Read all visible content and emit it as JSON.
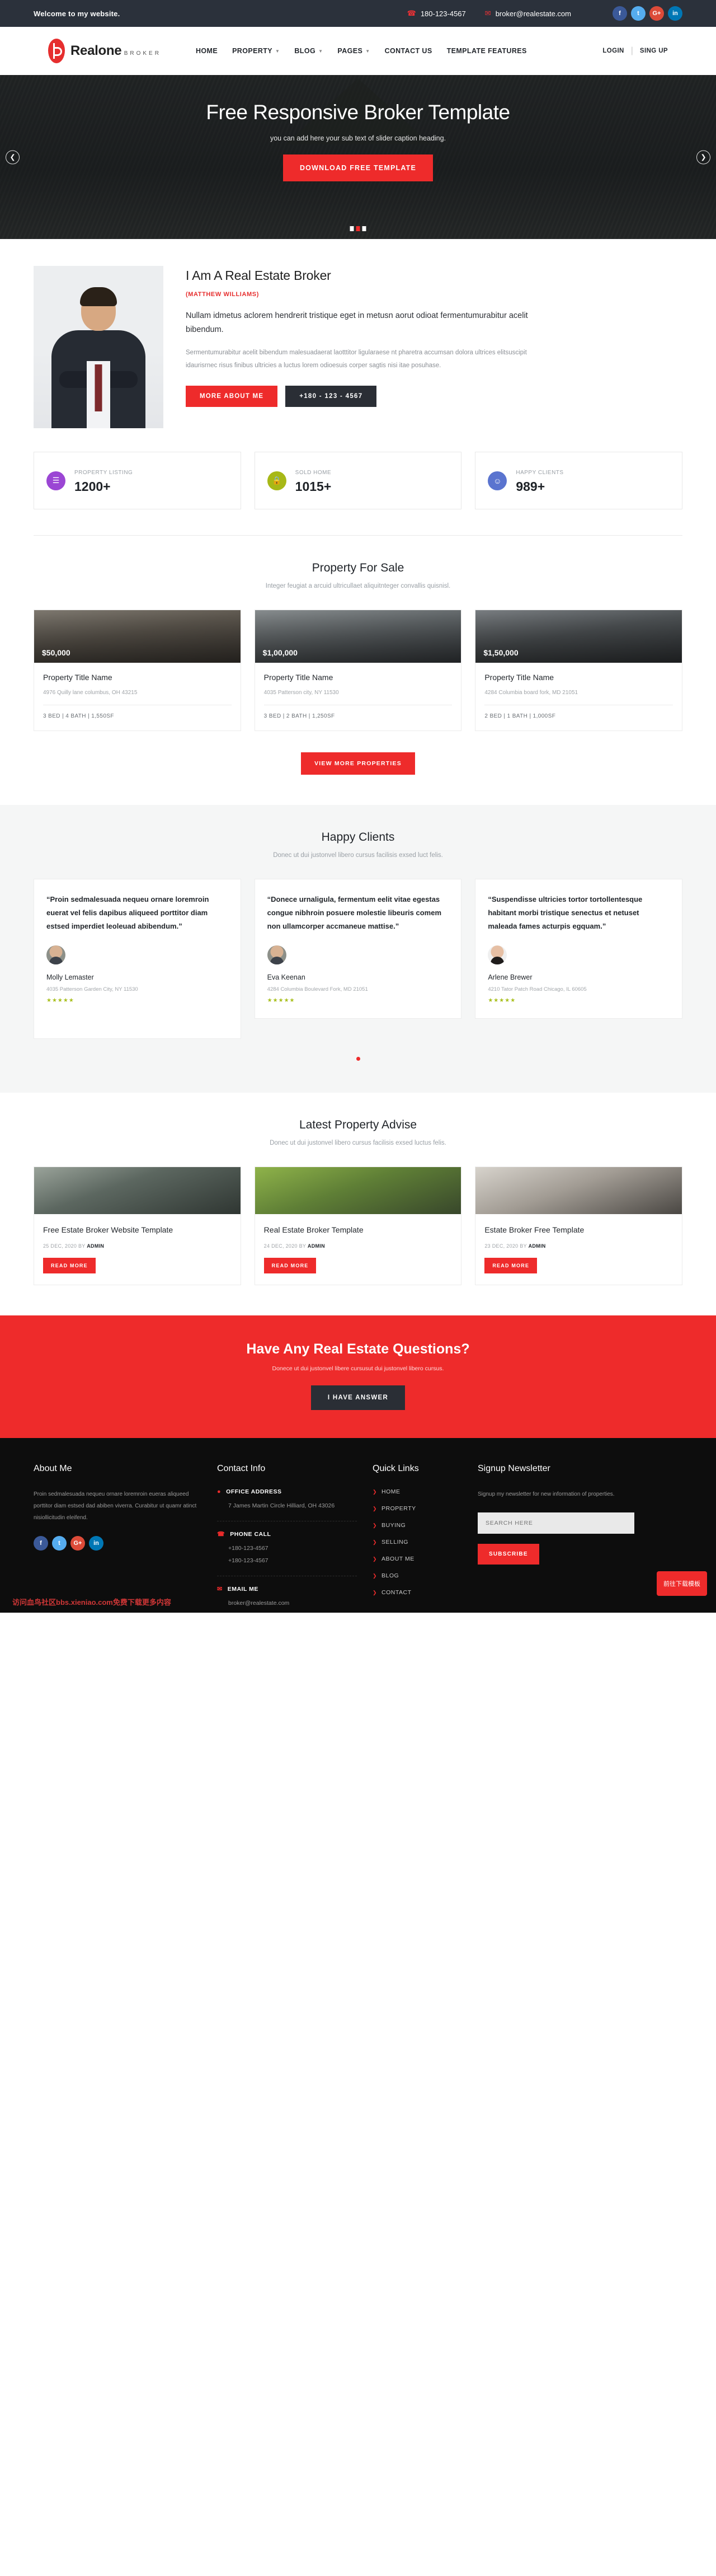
{
  "topbar": {
    "welcome": "Welcome to my website.",
    "phone": "180-123-4567",
    "email": "broker@realestate.com",
    "phone_icon": "phone-icon",
    "email_icon": "envelope-icon",
    "social": [
      {
        "name": "facebook",
        "glyph": "f"
      },
      {
        "name": "twitter",
        "glyph": "t"
      },
      {
        "name": "google-plus",
        "glyph": "G+"
      },
      {
        "name": "linkedin",
        "glyph": "in"
      }
    ]
  },
  "header": {
    "logo_name": "Realone",
    "logo_sub": "BROKER",
    "nav": [
      {
        "label": "HOME",
        "caret": false
      },
      {
        "label": "PROPERTY",
        "caret": true
      },
      {
        "label": "BLOG",
        "caret": true
      },
      {
        "label": "PAGES",
        "caret": true
      },
      {
        "label": "CONTACT US",
        "caret": false
      },
      {
        "label": "TEMPLATE FEATURES",
        "caret": false
      }
    ],
    "login": "LOGIN",
    "signup": "SING UP"
  },
  "hero": {
    "title": "Free Responsive Broker Template",
    "subtitle": "you can add here your sub text of slider caption heading.",
    "cta": "DOWNLOAD FREE TEMPLATE",
    "prev_icon": "chevron-left-icon",
    "next_icon": "chevron-right-icon",
    "slides": 3,
    "active_slide": 2
  },
  "intro": {
    "heading": "I Am A Real Estate Broker",
    "name": "(MATTHEW WILLIAMS)",
    "lead": "Nullam idmetus aclorem hendrerit tristique eget in metusn aorut odioat fermentumurabitur acelit bibendum.",
    "paragraph": "Sermentumurabitur acelit bibendum malesuadaerat laotttitor ligularaese nt pharetra accumsan dolora ultrices elitsuscipit idaurisrnec risus finibus ultricies a luctus lorem odioesuis corper sagtis nisi itae posuhase.",
    "btn_primary": "MORE ABOUT ME",
    "btn_phone": "+180 - 123 - 4567"
  },
  "stats": [
    {
      "label": "PROPERTY LISTING",
      "value": "1200+",
      "color": "#9b46d4",
      "icon": "list-icon",
      "glyph": "☰"
    },
    {
      "label": "SOLD HOME",
      "value": "1015+",
      "color": "#a7b817",
      "icon": "lock-icon",
      "glyph": "⚿"
    },
    {
      "label": "HAPPY CLIENTS",
      "value": "989+",
      "color": "#5a74cf",
      "icon": "smile-icon",
      "glyph": "☺"
    }
  ],
  "property_section": {
    "heading": "Property For Sale",
    "subheading": "Integer feugiat a arcuid ultricullaet aliquitnteger convallis quisnisl.",
    "more_button": "VIEW MORE PROPERTIES",
    "items": [
      {
        "price": "$50,000",
        "title": "Property Title Name",
        "address": "4976 Quilly lane columbus, OH 43215",
        "meta": "3 BED  |  4 BATH  |  1,550SF"
      },
      {
        "price": "$1,00,000",
        "title": "Property Title Name",
        "address": "4035 Patterson city, NY 11530",
        "meta": "3 BED  |  2 BATH  |  1,250SF"
      },
      {
        "price": "$1,50,000",
        "title": "Property Title Name",
        "address": "4284 Columbia board fork, MD 21051",
        "meta": "2 BED  |  1 BATH  |  1,000SF"
      }
    ]
  },
  "testimonial_section": {
    "heading": "Happy Clients",
    "subheading": "Donec ut dui justonvel libero cursus facilisis exsed luct felis.",
    "items": [
      {
        "quote": "“Proin sedmalesuada nequeu ornare loremroin euerat vel felis dapibus aliqueed porttitor diam estsed imperdiet leoleuad abibendum.”",
        "name": "Molly Lemaster",
        "address": "4035 Patterson Garden City, NY 11530",
        "stars": "★★★★★"
      },
      {
        "quote": "“Donece urnaligula, fermentum eelit vitae egestas congue nibhroin posuere molestie libeuris comem non ullamcorper accmaneue mattise.”",
        "name": "Eva Keenan",
        "address": "4284 Columbia Boulevard Fork, MD 21051",
        "stars": "★★★★★"
      },
      {
        "quote": "“Suspendisse ultricies tortor tortollentesque habitant morbi tristique senectus et netuset maleada fames acturpis egquam.”",
        "name": "Arlene Brewer",
        "address": "4210 Tator Patch Road Chicago, IL 60605",
        "stars": "★★★★★"
      }
    ]
  },
  "blog_section": {
    "heading": "Latest Property Advise",
    "subheading": "Donec ut dui justonvel libero cursus facilisis exsed luctus felis.",
    "items": [
      {
        "title": "Free Estate Broker Website Template",
        "date": "25 DEC, 2020",
        "by_label": "BY",
        "author": "ADMIN",
        "read": "READ MORE"
      },
      {
        "title": "Real Estate Broker Template",
        "date": "24 DEC, 2020",
        "by_label": "BY",
        "author": "ADMIN",
        "read": "READ MORE"
      },
      {
        "title": "Estate Broker Free Template",
        "date": "23 DEC, 2020",
        "by_label": "BY",
        "author": "ADMIN",
        "read": "READ MORE"
      }
    ]
  },
  "cta": {
    "heading": "Have Any Real Estate Questions?",
    "sub": "Donece ut dui justonvel libere cursusut dui justonvel libero cursus.",
    "button": "I HAVE ANSWER"
  },
  "footer": {
    "about": {
      "heading": "About Me",
      "text": "Proin sedmalesuada nequeu ornare loremroin eueras aliqueed porttitor diam estsed dad abiben viverra. Curabitur ut quamr atinct nisiollicitudin eleifend.",
      "social": [
        {
          "name": "facebook",
          "glyph": "f"
        },
        {
          "name": "twitter",
          "glyph": "t"
        },
        {
          "name": "google-plus",
          "glyph": "G+"
        },
        {
          "name": "linkedin",
          "glyph": "in"
        }
      ]
    },
    "contact": {
      "heading": "Contact Info",
      "address_label": "OFFICE ADDRESS",
      "address_value": "7 James Martin Circle Hilliard, OH 43026",
      "phone_label": "PHONE CALL",
      "phone_1": "+180-123-4567",
      "phone_2": "+180-123-4567",
      "email_label": "EMAIL ME",
      "email_value": "broker@realestate.com",
      "address_icon": "map-pin-icon",
      "phone_icon": "phone-icon",
      "email_icon": "envelope-icon"
    },
    "quick_links": {
      "heading": "Quick Links",
      "items": [
        "HOME",
        "PROPERTY",
        "BUYING",
        "SELLING",
        "ABOUT ME",
        "BLOG",
        "CONTACT"
      ]
    },
    "newsletter": {
      "heading": "Signup Newsletter",
      "text": "Signup my newsletter for new information of properties.",
      "placeholder": "SEARCH HERE",
      "value": "",
      "button": "SUBSCRIBE"
    },
    "badge": "前往下载模板",
    "watermark": "访问血鸟社区bbs.xieniao.com免费下载更多内容"
  },
  "colors": {
    "accent": "#ee2b2b",
    "dark": "#2b313b",
    "footer_bg": "#0d0d0d"
  }
}
